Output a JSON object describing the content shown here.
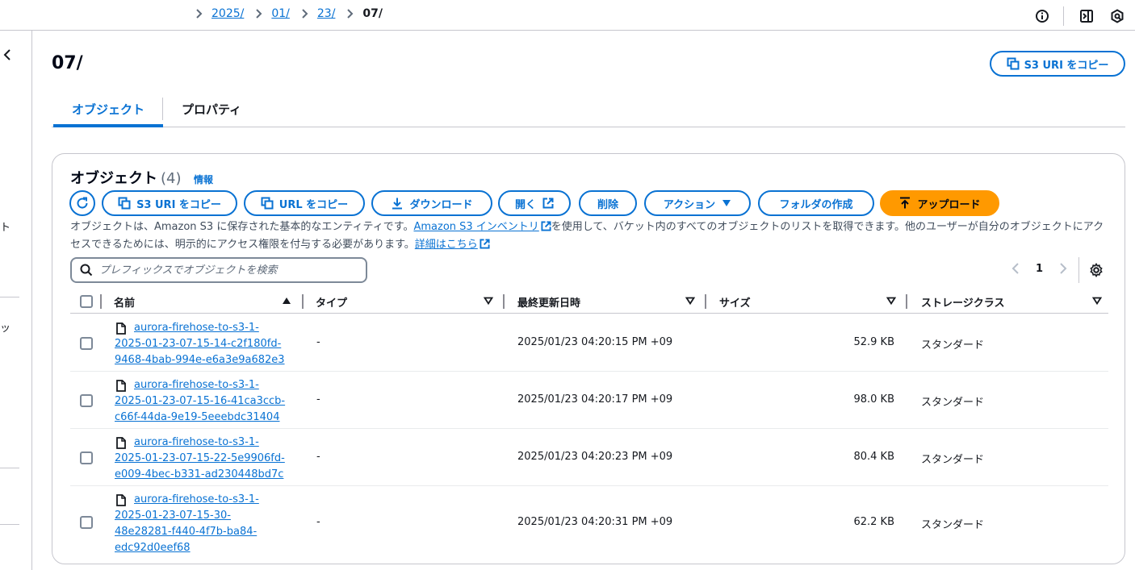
{
  "breadcrumb": {
    "items": [
      "2025/",
      "01/",
      "23/"
    ],
    "current": "07/"
  },
  "page": {
    "title": "07/",
    "copy_uri_label": "S3 URI をコピー"
  },
  "tabs": [
    "オブジェクト",
    "プロパティ"
  ],
  "objects_panel": {
    "title": "オブジェクト",
    "count": "(4)",
    "info_label": "情報",
    "buttons": {
      "copy_s3_uri": "S3 URI をコピー",
      "copy_url": "URL をコピー",
      "download": "ダウンロード",
      "open": "開く",
      "delete": "削除",
      "actions": "アクション",
      "create_folder": "フォルダの作成",
      "upload": "アップロード"
    },
    "description": {
      "part1": "オブジェクトは、Amazon S3 に保存された基本的なエンティティです。",
      "inventory_link": "Amazon S3 インベントリ",
      "part2": "を使用して、バケット内のすべてのオブジェクトのリストを取得できます。他のユーザーが自分のオブジェクトにアクセスできるためには、明示的にアクセス権限を付与する必要があります。",
      "details_link": "詳細はこちら"
    },
    "search_placeholder": "プレフィックスでオブジェクトを検索",
    "page_number": "1"
  },
  "table": {
    "columns": [
      "名前",
      "タイプ",
      "最終更新日時",
      "サイズ",
      "ストレージクラス"
    ],
    "rows": [
      {
        "name_lines": [
          "aurora-firehose-to-s3-1-",
          "2025-01-23-07-15-14-c2f180fd-",
          "9468-4bab-994e-e6a3e9a682e3"
        ],
        "type": "-",
        "modified": "2025/01/23 04:20:15 PM +09",
        "size": "52.9 KB",
        "storage": "スタンダード"
      },
      {
        "name_lines": [
          "aurora-firehose-to-s3-1-",
          "2025-01-23-07-15-16-41ca3ccb-",
          "c66f-44da-9e19-5eeebdc31404"
        ],
        "type": "-",
        "modified": "2025/01/23 04:20:17 PM +09",
        "size": "98.0 KB",
        "storage": "スタンダード"
      },
      {
        "name_lines": [
          "aurora-firehose-to-s3-1-",
          "2025-01-23-07-15-22-5e9906fd-",
          "e009-4bec-b331-ad230448bd7c"
        ],
        "type": "-",
        "modified": "2025/01/23 04:20:23 PM +09",
        "size": "80.4 KB",
        "storage": "スタンダード"
      },
      {
        "name_lines": [
          "aurora-firehose-to-s3-1-",
          "2025-01-23-07-15-30-",
          "48e28281-f440-4f7b-ba84-",
          "edc92d0eef68"
        ],
        "type": "-",
        "modified": "2025/01/23 04:20:31 PM +09",
        "size": "62.2 KB",
        "storage": "スタンダード"
      }
    ]
  },
  "left_rail": {
    "fragments": [
      "ト",
      "ッ"
    ]
  },
  "colors": {
    "accent": "#0972d3",
    "primary_button": "#ff9900",
    "border": "#c6c6cd"
  },
  "icons": [
    "info-icon",
    "panel-icon",
    "feedback-icon",
    "chevron-left-icon",
    "copy-icon",
    "refresh-icon",
    "download-icon",
    "external-link-icon",
    "caret-down-icon",
    "upload-icon",
    "search-icon",
    "gear-icon",
    "file-icon",
    "sort-asc-icon",
    "sort-desc-icon"
  ]
}
